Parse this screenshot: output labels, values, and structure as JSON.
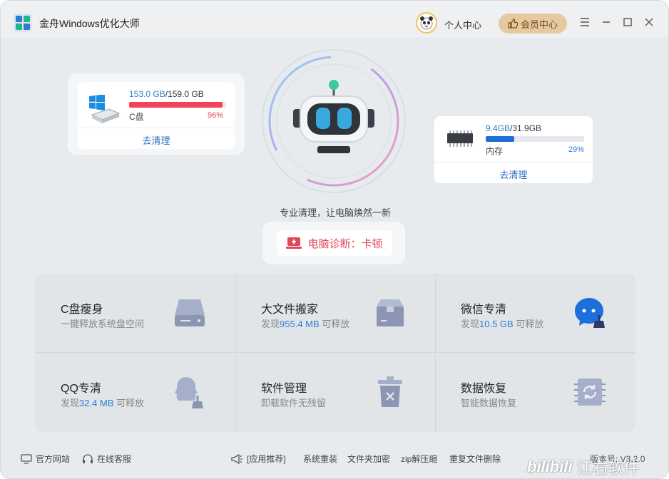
{
  "app": {
    "title": "金舟Windows优化大师",
    "personal_center": "个人中心",
    "vip_center": "会员中心"
  },
  "disk_card": {
    "used": "153.0 GB",
    "total": "/159.0 GB",
    "label": "C盘",
    "percent": "96%",
    "percent_value": 0.96,
    "action": "去清理",
    "bar_color": "#f2425a"
  },
  "memory_card": {
    "used": "9.4GB",
    "total": "/31.9GB",
    "label": "内存",
    "percent": "29%",
    "percent_value": 0.29,
    "action": "去清理",
    "bar_color": "#1f6fd6"
  },
  "slogan": "专业清理，让电脑焕然一新",
  "diagnosis": {
    "label": "电脑诊断：卡顿"
  },
  "tiles": [
    {
      "title": "C盘瘦身",
      "sub_pre": "一键释放系统盘空间",
      "sub_hl": "",
      "sub_post": ""
    },
    {
      "title": "大文件搬家",
      "sub_pre": "发现",
      "sub_hl": "955.4 MB",
      "sub_post": " 可释放"
    },
    {
      "title": "微信专清",
      "sub_pre": "发现",
      "sub_hl": "10.5 GB",
      "sub_post": " 可释放"
    },
    {
      "title": "QQ专清",
      "sub_pre": "发现",
      "sub_hl": "32.4 MB",
      "sub_post": " 可释放"
    },
    {
      "title": "软件管理",
      "sub_pre": "卸载软件无残留",
      "sub_hl": "",
      "sub_post": ""
    },
    {
      "title": "数据恢复",
      "sub_pre": "智能数据恢复",
      "sub_hl": "",
      "sub_post": ""
    }
  ],
  "footer": {
    "website": "官方网站",
    "service": "在线客服",
    "recommend": "[应用推荐]",
    "links": [
      "系统重装",
      "文件夹加密",
      "zip解压缩",
      "重复文件删除"
    ],
    "version": "版本号: V3.2.0"
  },
  "watermark": {
    "brand": "bilibili",
    "text": "江右软件"
  },
  "colors": {
    "accent_blue": "#2d7fd0",
    "alert_red": "#e24756",
    "vip_gold": "#e4c9a1"
  }
}
